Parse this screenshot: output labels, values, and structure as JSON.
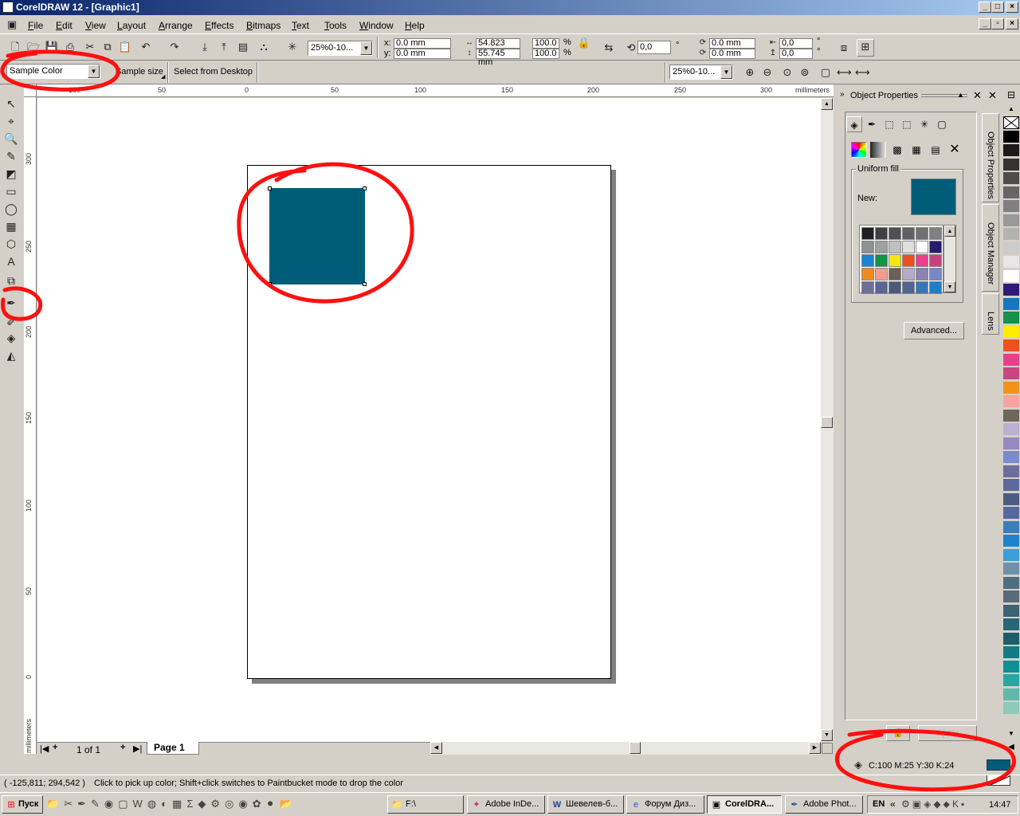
{
  "window": {
    "title": "CorelDRAW 12 - [Graphic1]"
  },
  "menu": [
    "File",
    "Edit",
    "View",
    "Layout",
    "Arrange",
    "Effects",
    "Bitmaps",
    "Text",
    "Tools",
    "Window",
    "Help"
  ],
  "toolbar": {
    "zoom": "25%0-10...",
    "x": "x: 0.0 mm",
    "y": "y: 0.0 mm",
    "width": "54.823 mm",
    "height": "55.745 mm",
    "scale_w": "100.0",
    "scale_h": "100.0",
    "pct": "%",
    "rotation": "0,0",
    "deg": "°",
    "pos1": "0.0 mm",
    "pos2": "0.0 mm",
    "skew1": "0,0",
    "skew2": "0,0"
  },
  "propertybar": {
    "mode": "Sample Color",
    "sample_size": "Sample size",
    "select_desktop": "Select from Desktop",
    "zoom": "25%0-10..."
  },
  "rulers": {
    "h_labels": [
      "100",
      "50",
      "0",
      "50",
      "100",
      "150",
      "200",
      "250",
      "300"
    ],
    "h_unit": "millimeters",
    "v_labels": [
      "300",
      "250",
      "200",
      "150",
      "100",
      "50",
      "0"
    ],
    "v_unit": "millimeters"
  },
  "pagebar": {
    "count": "1 of 1",
    "tab": "Page 1"
  },
  "docker": {
    "title": "Object Properties",
    "fill_group": "Uniform fill",
    "new_label": "New:",
    "advanced_button": "Advanced...",
    "apply_button": "Apply",
    "tabs": [
      "Object Properties",
      "Object Manager",
      "Lens"
    ]
  },
  "colors": {
    "fill": "#005d79",
    "grid": [
      "#202020",
      "#404040",
      "#505050",
      "#606060",
      "#707070",
      "#808080",
      "#909090",
      "#a0a0a0",
      "#c0c0c0",
      "#e0e0e0",
      "#ffffff",
      "#2a1a6e",
      "#1e82d2",
      "#129447",
      "#f5e60f",
      "#ef4f1c",
      "#ed3d8b",
      "#c7427c",
      "#f08c1e",
      "#f59b91",
      "#6c5f55",
      "#b4aac8",
      "#8c82b4",
      "#7887c8",
      "#6e6e96",
      "#5a6496",
      "#4b5a78",
      "#506496",
      "#3778b4",
      "#1e7dc8"
    ],
    "palette": [
      "none",
      "#000000",
      "#1a1a1a",
      "#333333",
      "#4d4d4d",
      "#666666",
      "#808080",
      "#999999",
      "#b3b3b3",
      "#cccccc",
      "#e6e6e6",
      "#ffffff",
      "#2e1a78",
      "#1478be",
      "#14914b",
      "#ffec00",
      "#ee5020",
      "#ec3c8c",
      "#c8467e",
      "#f39218",
      "#f7a3a0",
      "#6f655b",
      "#b9b0d2",
      "#958ac0",
      "#7b8bcd",
      "#6c6f9d",
      "#5d689d",
      "#4c5c7e",
      "#546a9e",
      "#3b7dbb",
      "#1f82cd",
      "#3d9ed8",
      "#6f90a9",
      "#4e6f80",
      "#596b78",
      "#3e6372",
      "#2a6677",
      "#1e5d68",
      "#117b85",
      "#0f9095",
      "#28a6a2",
      "#60b8aa",
      "#8ecab7"
    ]
  },
  "status": {
    "fill_info": "C:100 M:25 Y:30 K:24",
    "coords": "( -125,811; 294,542 )",
    "hint": "Click to pick up color; Shift+click switches to Paintbucket mode to drop the color"
  },
  "taskbar": {
    "start": "Пуск",
    "items": [
      "F:\\",
      "Adobe InDe...",
      "Шевелев-б...",
      "Форум Диз...",
      "CorelDRA...",
      "Adobe Phot..."
    ],
    "clock": "14:47"
  }
}
